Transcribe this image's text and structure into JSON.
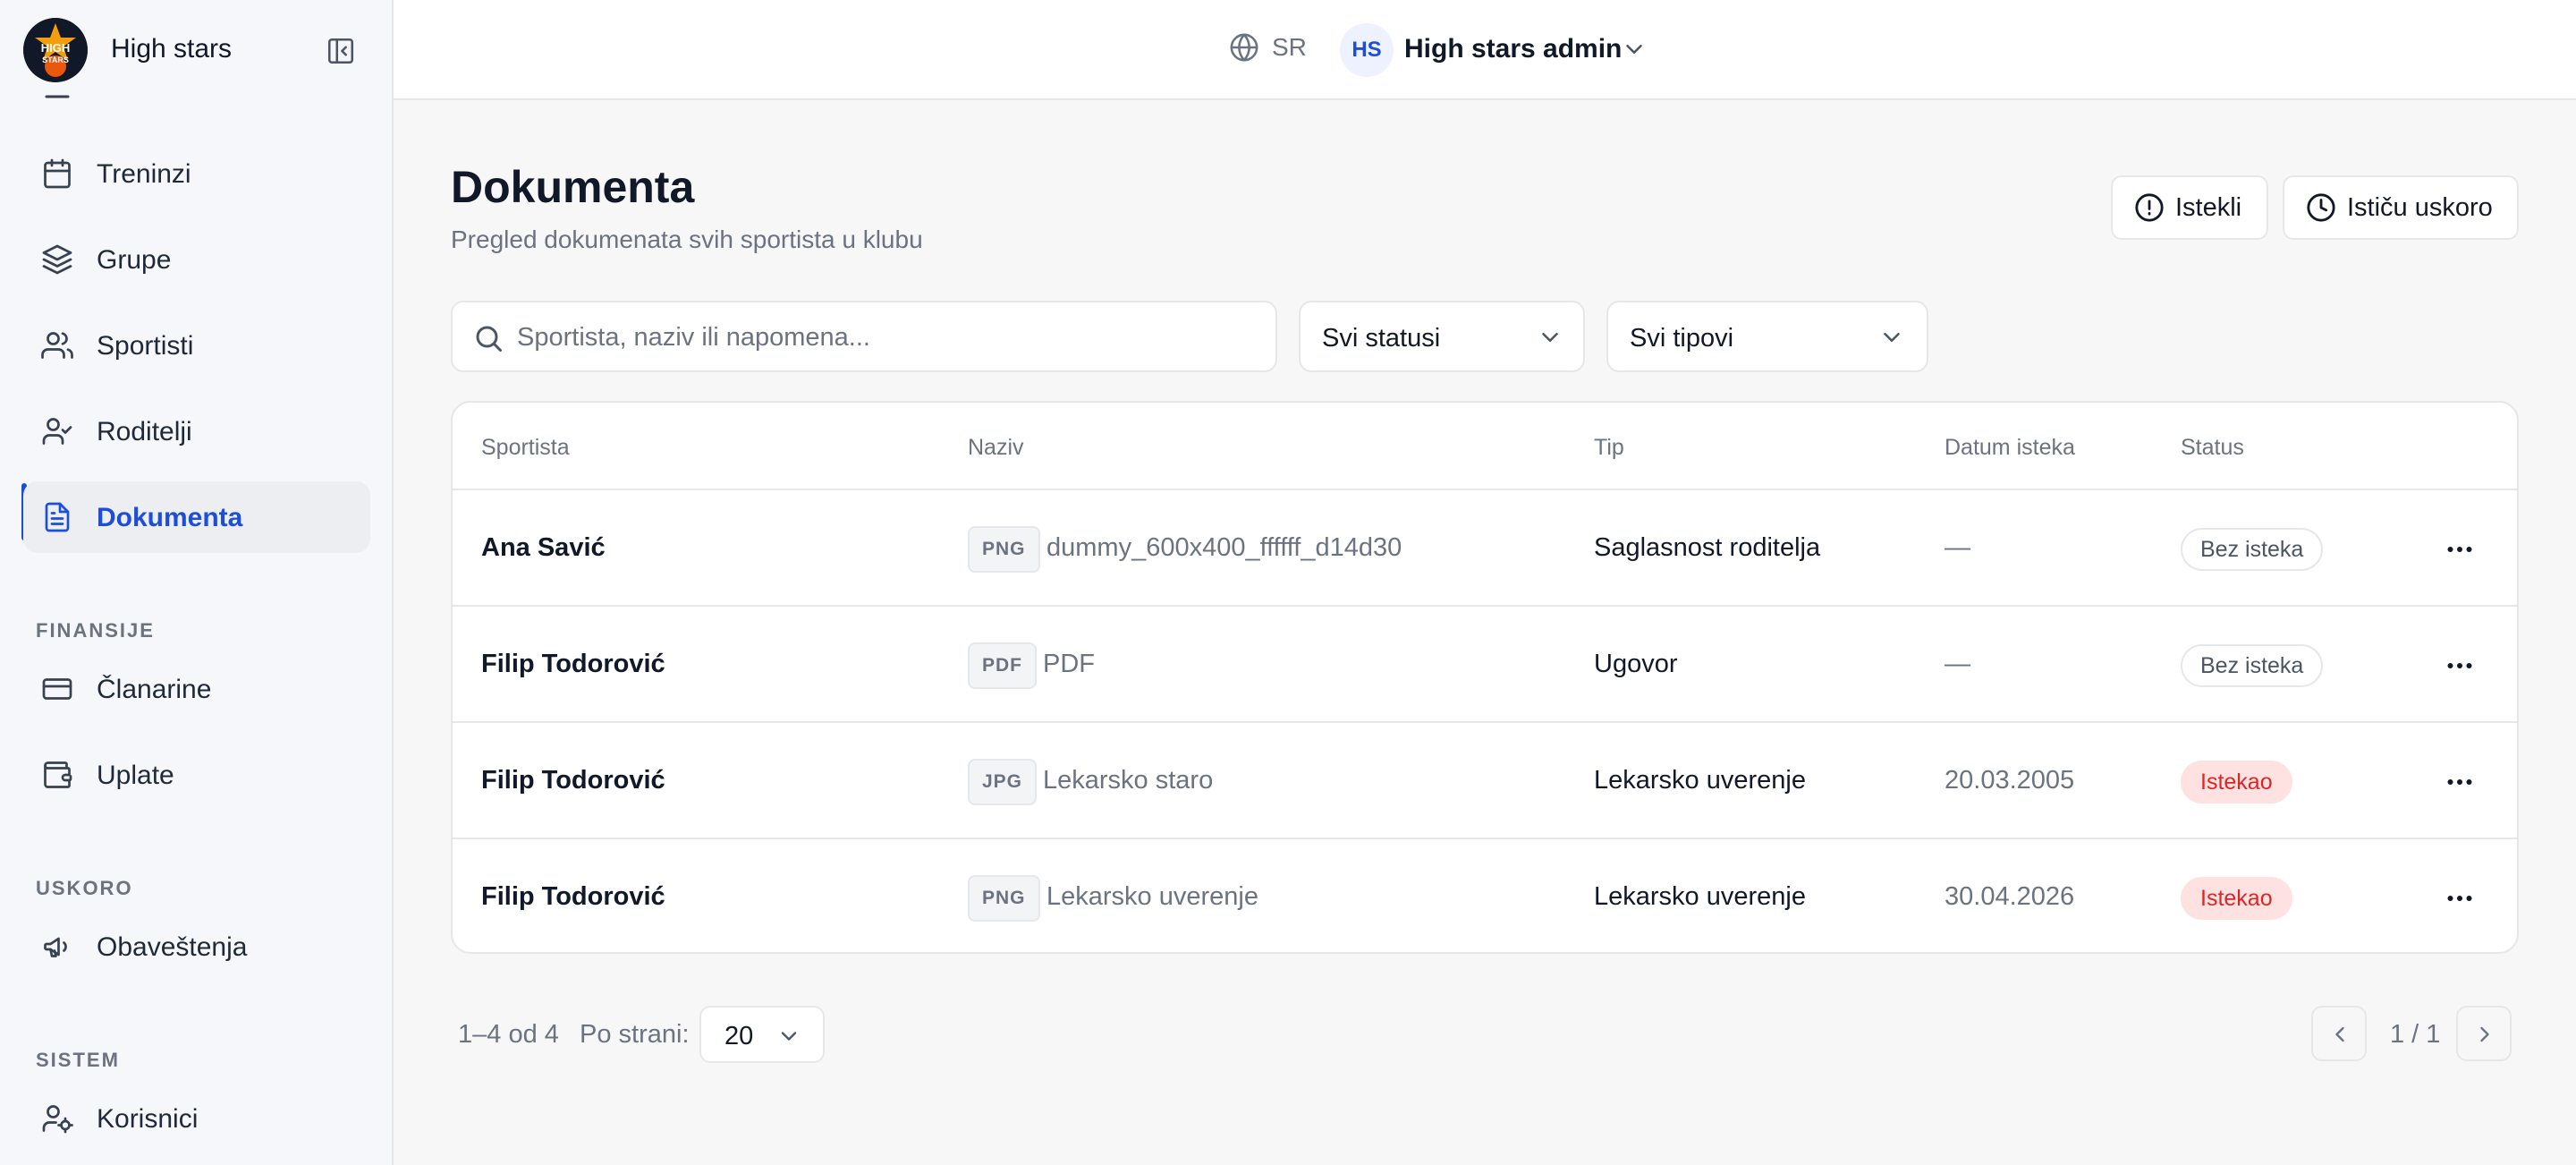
{
  "app": {
    "brand": "High stars",
    "logo_text": "HIGH STARS"
  },
  "sidebar": {
    "items": [
      {
        "label": "Treninzi",
        "icon": "calendar-icon"
      },
      {
        "label": "Grupe",
        "icon": "layers-icon"
      },
      {
        "label": "Sportisti",
        "icon": "users-icon"
      },
      {
        "label": "Roditelji",
        "icon": "user-check-icon"
      },
      {
        "label": "Dokumenta",
        "icon": "file-text-icon",
        "active": true
      }
    ],
    "sections": [
      {
        "title": "FINANSIJE",
        "items": [
          {
            "label": "Članarine",
            "icon": "credit-card-icon"
          },
          {
            "label": "Uplate",
            "icon": "wallet-icon"
          }
        ]
      },
      {
        "title": "USKORO",
        "items": [
          {
            "label": "Obaveštenja",
            "icon": "megaphone-icon"
          }
        ]
      },
      {
        "title": "SISTEM",
        "items": [
          {
            "label": "Korisnici",
            "icon": "user-cog-icon"
          }
        ]
      }
    ]
  },
  "topbar": {
    "language": "SR",
    "user_initials": "HS",
    "user_name": "High stars admin"
  },
  "page": {
    "title": "Dokumenta",
    "subtitle": "Pregled dokumenata svih sportista u klubu",
    "buttons": {
      "expired": "Istekli",
      "expiring_soon": "Ističu uskoro"
    }
  },
  "filters": {
    "search_placeholder": "Sportista, naziv ili napomena...",
    "status_value": "Svi statusi",
    "type_value": "Svi tipovi"
  },
  "table": {
    "columns": [
      "Sportista",
      "Naziv",
      "Tip",
      "Datum isteka",
      "Status"
    ],
    "rows": [
      {
        "athlete": "Ana Savić",
        "file_type": "PNG",
        "file_name": "dummy_600x400_ffffff_d14d30",
        "doc_type": "Saglasnost roditelja",
        "expiry": "—",
        "status": "Bez isteka"
      },
      {
        "athlete": "Filip Todorović",
        "file_type": "PDF",
        "file_name": "PDF",
        "doc_type": "Ugovor",
        "expiry": "—",
        "status": "Bez isteka"
      },
      {
        "athlete": "Filip Todorović",
        "file_type": "JPG",
        "file_name": "Lekarsko staro",
        "doc_type": "Lekarsko uverenje",
        "expiry": "20.03.2005",
        "status": "Istekao"
      },
      {
        "athlete": "Filip Todorović",
        "file_type": "PNG",
        "file_name": "Lekarsko uverenje",
        "doc_type": "Lekarsko uverenje",
        "expiry": "30.04.2026",
        "status": "Istekao"
      }
    ]
  },
  "pagination": {
    "range": "1–4 od 4",
    "per_page_label": "Po strani:",
    "per_page_value": "20",
    "page_info": "1 / 1"
  },
  "colors": {
    "accent": "#1d4ed8",
    "expired_bg": "#fee2e2",
    "expired_text": "#dc2626"
  }
}
